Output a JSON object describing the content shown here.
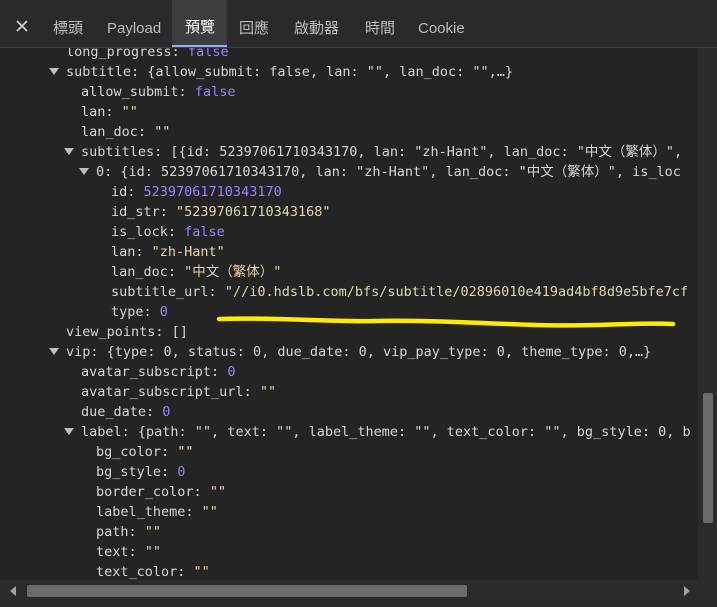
{
  "tabs": [
    {
      "label": "標頭"
    },
    {
      "label": "Payload"
    },
    {
      "label": "預覽"
    },
    {
      "label": "回應"
    },
    {
      "label": "啟動器"
    },
    {
      "label": "時間"
    },
    {
      "label": "Cookie"
    }
  ],
  "active_tab": "預覽",
  "tree": {
    "r0": {
      "key": "long_progress",
      "val": "false"
    },
    "r1": {
      "key": "subtitle",
      "summary": "{allow_submit: false, lan: \"\", lan_doc: \"\",…}"
    },
    "r2": {
      "key": "allow_submit",
      "val": "false"
    },
    "r3": {
      "key": "lan",
      "val": "\"\""
    },
    "r4": {
      "key": "lan_doc",
      "val": "\"\""
    },
    "r5": {
      "key": "subtitles",
      "summary": "[{id: 52397061710343170, lan: \"zh-Hant\", lan_doc: \"中文（繁体）\","
    },
    "r6": {
      "key": "0",
      "summary": "{id: 52397061710343170, lan: \"zh-Hant\", lan_doc: \"中文（繁体）\", is_loc"
    },
    "r7": {
      "key": "id",
      "val": "52397061710343170"
    },
    "r8": {
      "key": "id_str",
      "val": "\"52397061710343168\""
    },
    "r9": {
      "key": "is_lock",
      "val": "false"
    },
    "r10": {
      "key": "lan",
      "val": "\"zh-Hant\""
    },
    "r11": {
      "key": "lan_doc",
      "val": "\"中文（繁体）\""
    },
    "r12": {
      "key": "subtitle_url",
      "val": "\"//i0.hdslb.com/bfs/subtitle/02896010e419ad4bf8d9e5bfe7cf"
    },
    "r13": {
      "key": "type",
      "val": "0"
    },
    "r14": {
      "key": "view_points",
      "val": "[]"
    },
    "r15": {
      "key": "vip",
      "summary": "{type: 0, status: 0, due_date: 0, vip_pay_type: 0, theme_type: 0,…}"
    },
    "r16": {
      "key": "avatar_subscript",
      "val": "0"
    },
    "r17": {
      "key": "avatar_subscript_url",
      "val": "\"\""
    },
    "r18": {
      "key": "due_date",
      "val": "0"
    },
    "r19": {
      "key": "label",
      "summary": "{path: \"\", text: \"\", label_theme: \"\", text_color: \"\", bg_style: 0, b"
    },
    "r20": {
      "key": "bg_color",
      "val": "\"\""
    },
    "r21": {
      "key": "bg_style",
      "val": "0"
    },
    "r22": {
      "key": "border_color",
      "val": "\"\""
    },
    "r23": {
      "key": "label_theme",
      "val": "\"\""
    },
    "r24": {
      "key": "path",
      "val": "\"\""
    },
    "r25": {
      "key": "text",
      "val": "\"\""
    },
    "r26": {
      "key": "text_color",
      "val": "\"\""
    }
  },
  "colors": {
    "highlight_underline": "#ffea00",
    "tab_active": "#8ab4f8"
  }
}
